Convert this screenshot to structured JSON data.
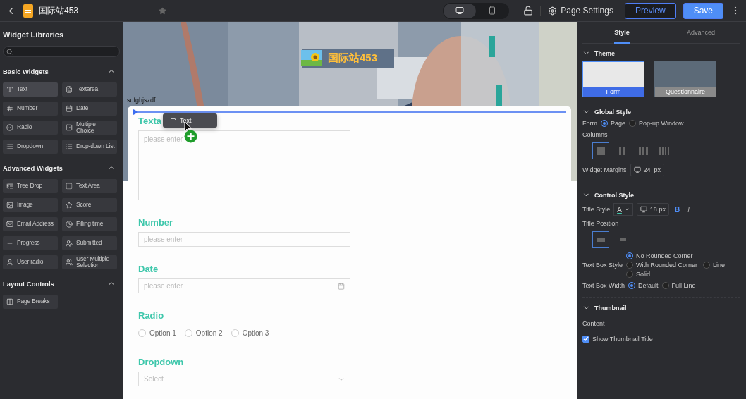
{
  "topbar": {
    "title": "国际站453",
    "starred": false,
    "devices": [
      {
        "kind": "desktop",
        "selected": true
      },
      {
        "kind": "mobile",
        "selected": false
      }
    ],
    "page_settings": "Page Settings",
    "preview": "Preview",
    "save": "Save"
  },
  "sidebar": {
    "title": "Widget Libraries",
    "sections": [
      {
        "title": "Basic Widgets",
        "expanded": true,
        "items": [
          {
            "label": "Text",
            "selected": true
          },
          {
            "label": "Textarea",
            "selected": false
          },
          {
            "label": "Number",
            "selected": false
          },
          {
            "label": "Date",
            "selected": false
          },
          {
            "label": "Radio",
            "selected": false
          },
          {
            "label": "Multiple Choice",
            "selected": false
          },
          {
            "label": "Dropdown",
            "selected": false
          },
          {
            "label": "Drop-down List",
            "selected": false
          }
        ]
      },
      {
        "title": "Advanced Widgets",
        "expanded": true,
        "items": [
          {
            "label": "Tree Drop",
            "selected": false
          },
          {
            "label": "Text Area",
            "selected": false
          },
          {
            "label": "Image",
            "selected": false
          },
          {
            "label": "Score",
            "selected": false
          },
          {
            "label": "Email Address",
            "selected": false
          },
          {
            "label": "Filling time",
            "selected": false
          },
          {
            "label": "Progress",
            "selected": false
          },
          {
            "label": "Submitted",
            "selected": false
          },
          {
            "label": "User radio",
            "selected": false
          },
          {
            "label": "User Multiple Selection",
            "selected": false
          }
        ]
      },
      {
        "title": "Layout Controls",
        "expanded": true,
        "items": [
          {
            "label": "Page Breaks",
            "selected": false
          }
        ]
      }
    ]
  },
  "canvas": {
    "banner_title": "国际站453",
    "banner_label": "sdfghjszdf",
    "drag_ghost": {
      "label": "Text"
    },
    "fields": [
      {
        "kind": "textarea",
        "title": "Texta",
        "placeholder": "please enter"
      },
      {
        "kind": "input",
        "title": "Number",
        "placeholder": "please enter"
      },
      {
        "kind": "date",
        "title": "Date",
        "placeholder": "please enter"
      },
      {
        "kind": "radio",
        "title": "Radio",
        "options": [
          {
            "label": "Option 1",
            "selected": false
          },
          {
            "label": "Option 2",
            "selected": false
          },
          {
            "label": "Option 3",
            "selected": false
          }
        ]
      },
      {
        "kind": "select",
        "title": "Dropdown",
        "placeholder": "Select"
      }
    ]
  },
  "properties": {
    "tabs": [
      {
        "label": "Style",
        "selected": true
      },
      {
        "label": "Advanced",
        "selected": false
      }
    ],
    "theme": {
      "title": "Theme",
      "expanded": true,
      "options": [
        {
          "label": "Form",
          "selected": true
        },
        {
          "label": "Questionnaire",
          "selected": false
        }
      ]
    },
    "global_style": {
      "title": "Global Style",
      "expanded": true,
      "form_label": "Form",
      "form_options": [
        {
          "label": "Page",
          "selected": true
        },
        {
          "label": "Pop-up Window",
          "selected": false
        }
      ],
      "columns_label": "Columns",
      "columns": [
        {
          "selected": true
        },
        {
          "selected": false
        },
        {
          "selected": false
        },
        {
          "selected": false
        }
      ],
      "margins_label": "Widget Margins",
      "margins_value": "24",
      "margins_unit": "px"
    },
    "control_style": {
      "title": "Control Style",
      "expanded": true,
      "title_style_label": "Title Style",
      "title_color_glyph": "A",
      "title_size": "18",
      "title_unit": "px",
      "bold": {
        "glyph": "B",
        "on": true
      },
      "italic": {
        "glyph": "I",
        "on": false
      },
      "position_label": "Title Position",
      "positions": [
        {
          "selected": true
        },
        {
          "selected": false
        }
      ],
      "box_style_label": "Text Box Style",
      "box_styles": [
        {
          "label": "No Rounded Corner",
          "selected": true
        },
        {
          "label": "With Rounded Corner",
          "selected": false
        },
        {
          "label": "Line",
          "selected": false
        },
        {
          "label": "Solid",
          "selected": false
        }
      ],
      "box_width_label": "Text Box Width",
      "box_widths": [
        {
          "label": "Default",
          "selected": true
        },
        {
          "label": "Full Line",
          "selected": false
        }
      ]
    },
    "thumbnail": {
      "title": "Thumbnail",
      "expanded": true,
      "content_label": "Content",
      "show_title": {
        "label": "Show Thumbnail Title",
        "checked": true
      }
    }
  }
}
